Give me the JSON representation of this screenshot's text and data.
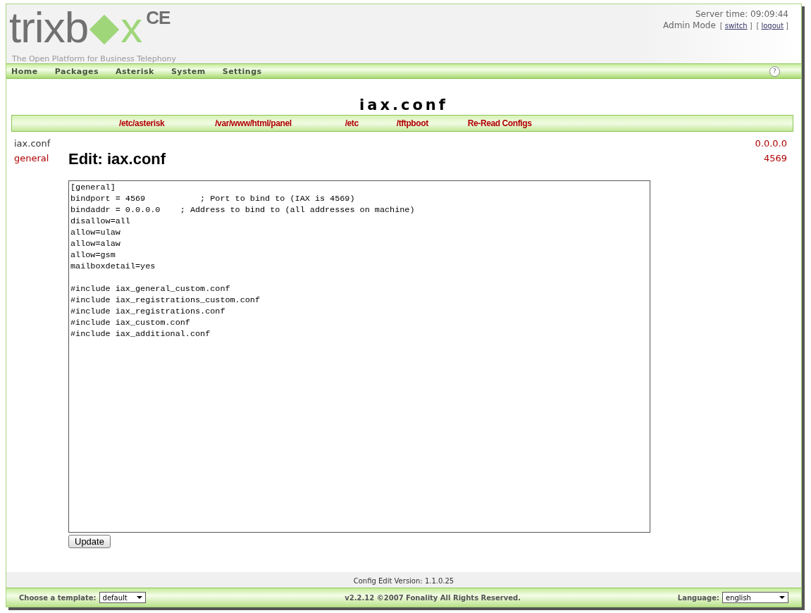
{
  "header": {
    "logo": {
      "before": "trixb",
      "after": "x",
      "edition": "CE"
    },
    "tagline": "The Open Platform for Business Telephony",
    "server_time": "Server time: 09:09:44",
    "mode": "Admin Mode",
    "mode_links": [
      {
        "open": "[",
        "label": "switch",
        "close": "]"
      },
      {
        "open": "[",
        "label": "logout",
        "close": "]"
      }
    ]
  },
  "nav": {
    "items": [
      "Home",
      "Packages",
      "Asterisk",
      "System",
      "Settings"
    ],
    "help": "?"
  },
  "page_title": "iax.conf",
  "dir_links": [
    "/etc/asterisk",
    "/var/www/html/panel",
    "/etc",
    "/tftpboot",
    "Re-Read Configs"
  ],
  "sidebar": {
    "items": [
      {
        "label": "iax.conf",
        "selected": true
      },
      {
        "label": "general",
        "selected": false
      }
    ]
  },
  "edit_title": "Edit: iax.conf",
  "right_values": [
    "0.0.0.0",
    "4569"
  ],
  "editor": {
    "value": "[general]\nbindport = 4569           ; Port to bind to (IAX is 4569)\nbindaddr = 0.0.0.0    ; Address to bind to (all addresses on machine)\ndisallow=all\nallow=ulaw\nallow=alaw\nallow=gsm\nmailboxdetail=yes\n\n#include iax_general_custom.conf\n#include iax_registrations_custom.conf\n#include iax_registrations.conf\n#include iax_custom.conf\n#include iax_additional.conf"
  },
  "update_button": "Update",
  "version": "Config Edit Version: 1.1.0.25",
  "footer": {
    "template_label": "Choose a template:",
    "template": "default",
    "copyright": "v2.2.12 ©2007 Fonality All Rights Reserved.",
    "language_label": "Language:",
    "language": "english"
  }
}
